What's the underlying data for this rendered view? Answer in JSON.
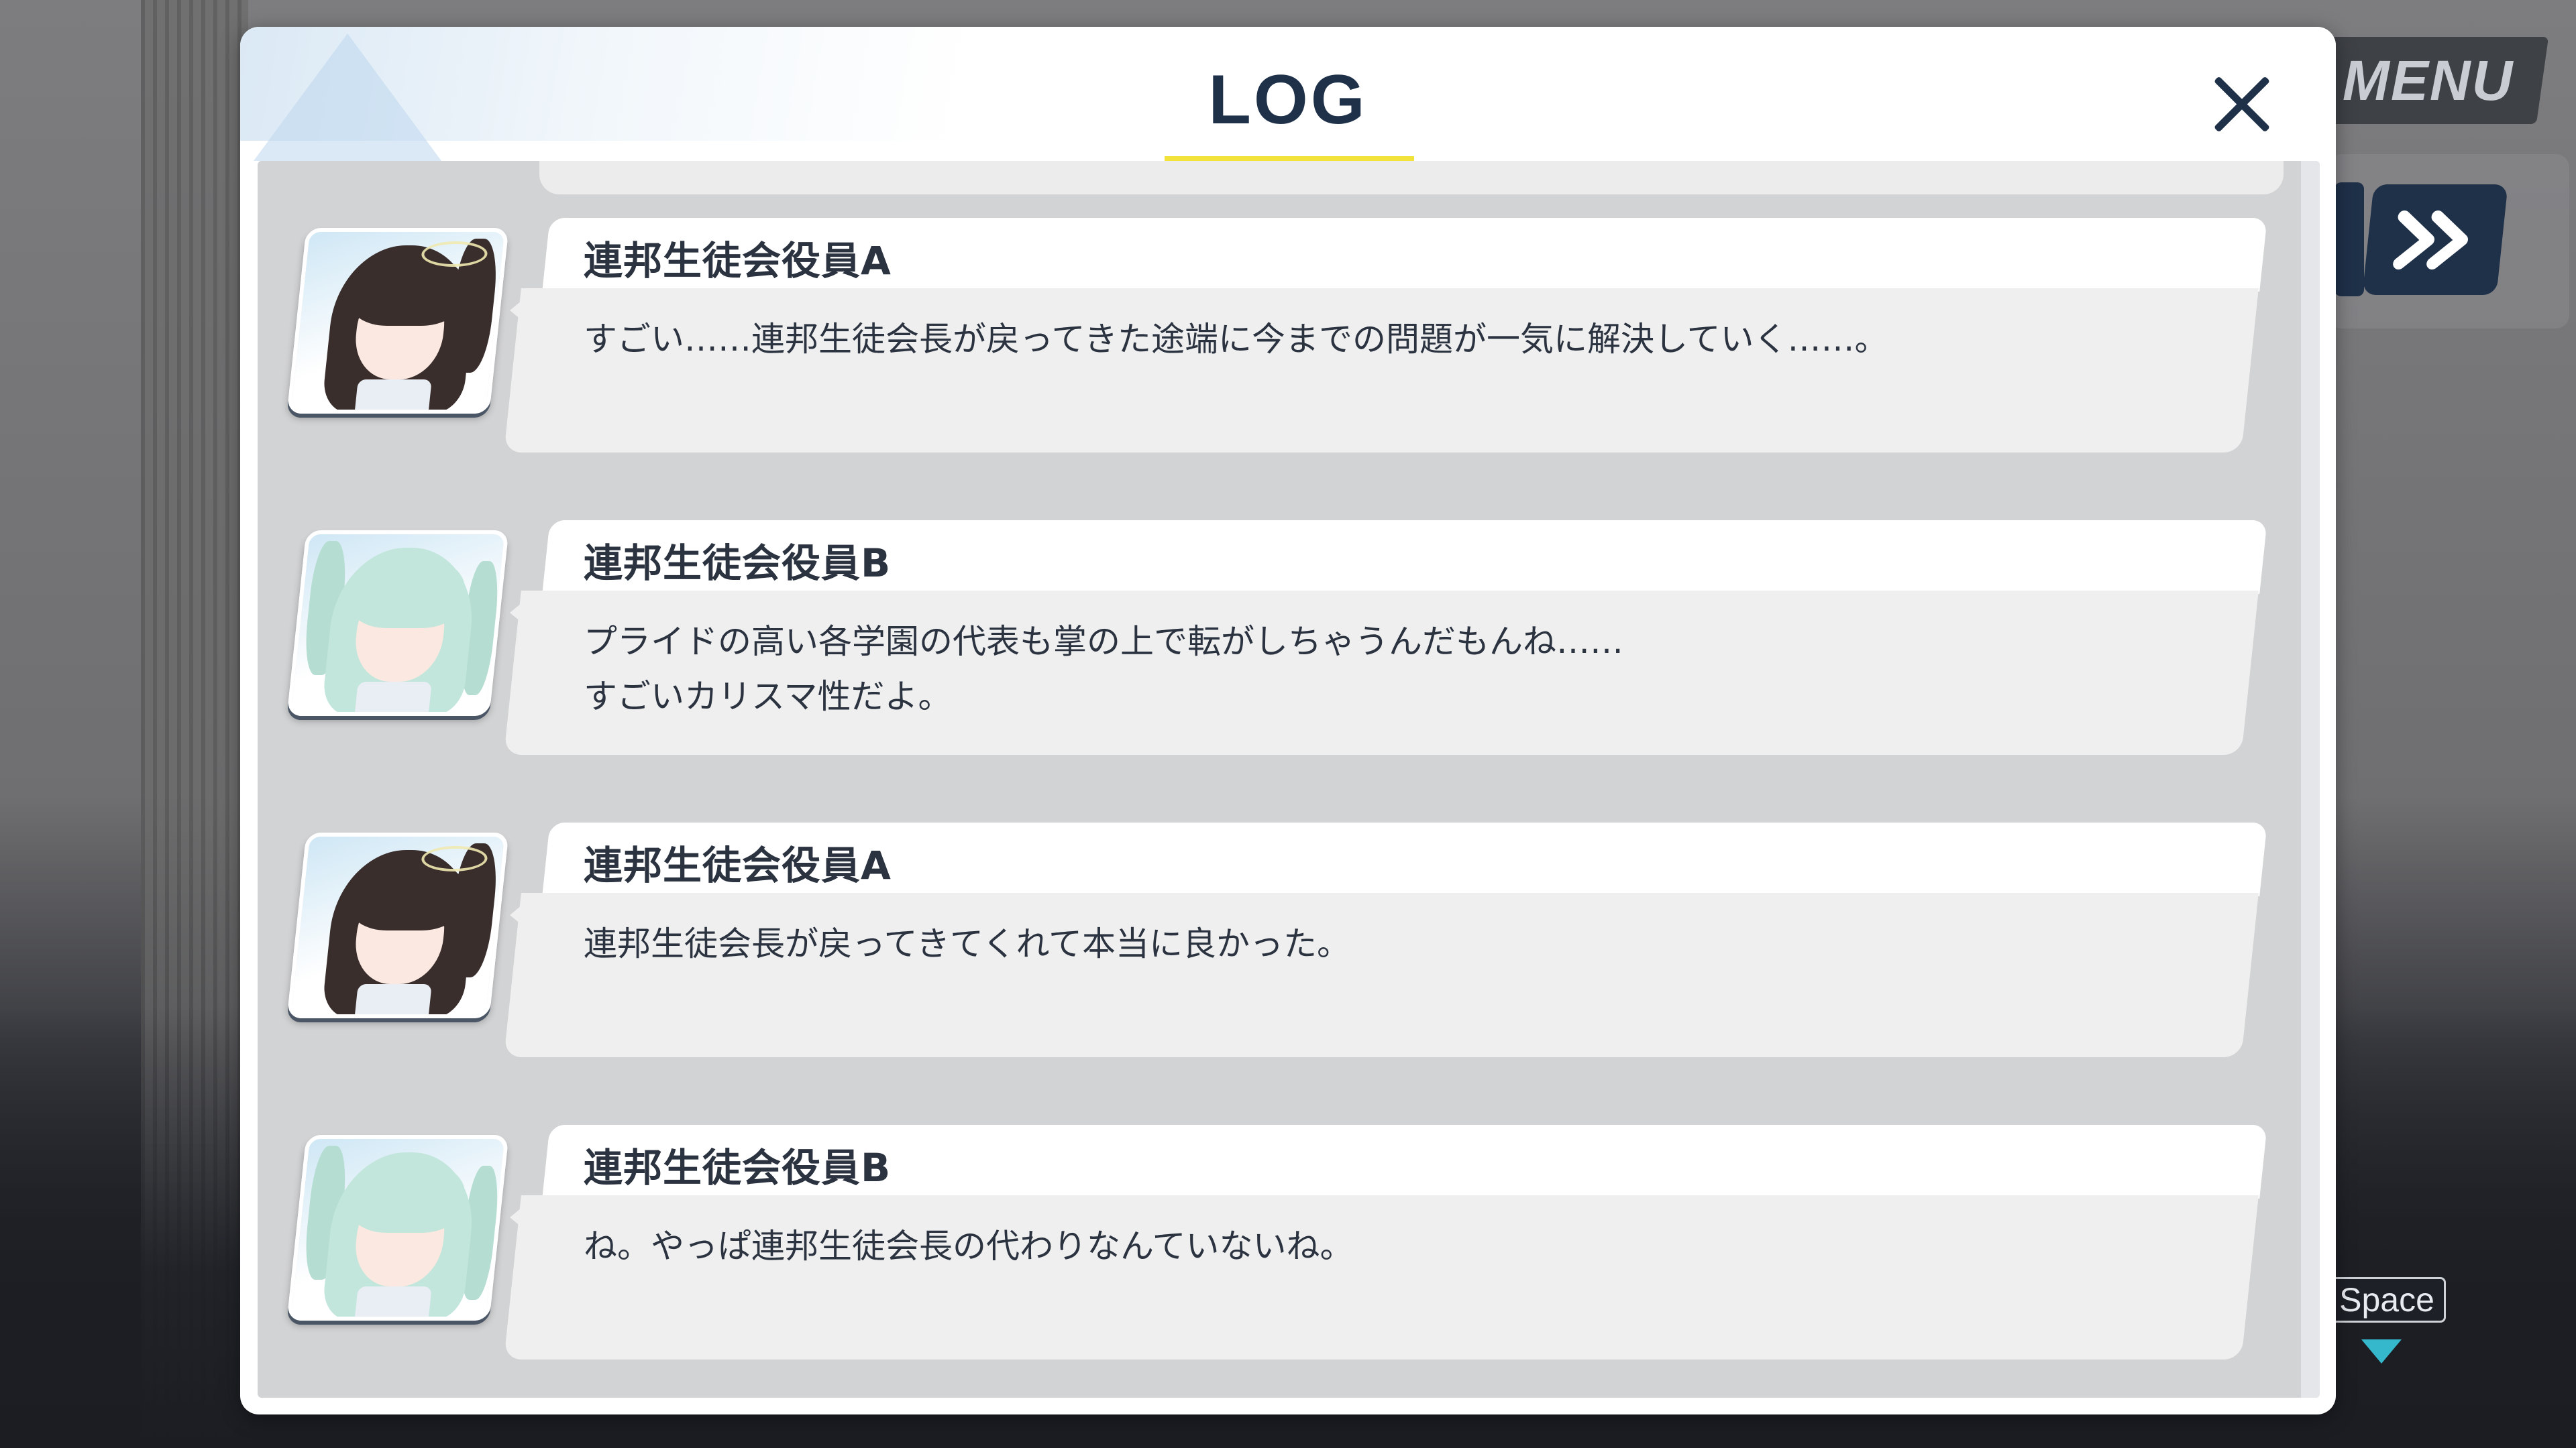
{
  "hud": {
    "menu_label": "MENU",
    "space_label": "Space"
  },
  "log": {
    "title": "LOG",
    "entries": [
      {
        "speaker": "連邦生徒会役員A",
        "text": "すごい……連邦生徒会長が戻ってきた途端に今までの問題が一気に解決していく……。",
        "avatar": "dark"
      },
      {
        "speaker": "連邦生徒会役員B",
        "text": "プライドの高い各学園の代表も掌の上で転がしちゃうんだもんね……\nすごいカリスマ性だよ。",
        "avatar": "mint"
      },
      {
        "speaker": "連邦生徒会役員A",
        "text": "連邦生徒会長が戻ってきてくれて本当に良かった。",
        "avatar": "dark"
      },
      {
        "speaker": "連邦生徒会役員B",
        "text": "ね。やっぱ連邦生徒会長の代わりなんていないね。",
        "avatar": "mint"
      }
    ]
  },
  "colors": {
    "title": "#1f3049",
    "underline": "#f1e33a",
    "accent_button": "#1f3049",
    "space_arrow": "#36b8cc"
  },
  "icons": [
    "close-icon",
    "fast-forward-icon",
    "down-arrow-icon"
  ]
}
